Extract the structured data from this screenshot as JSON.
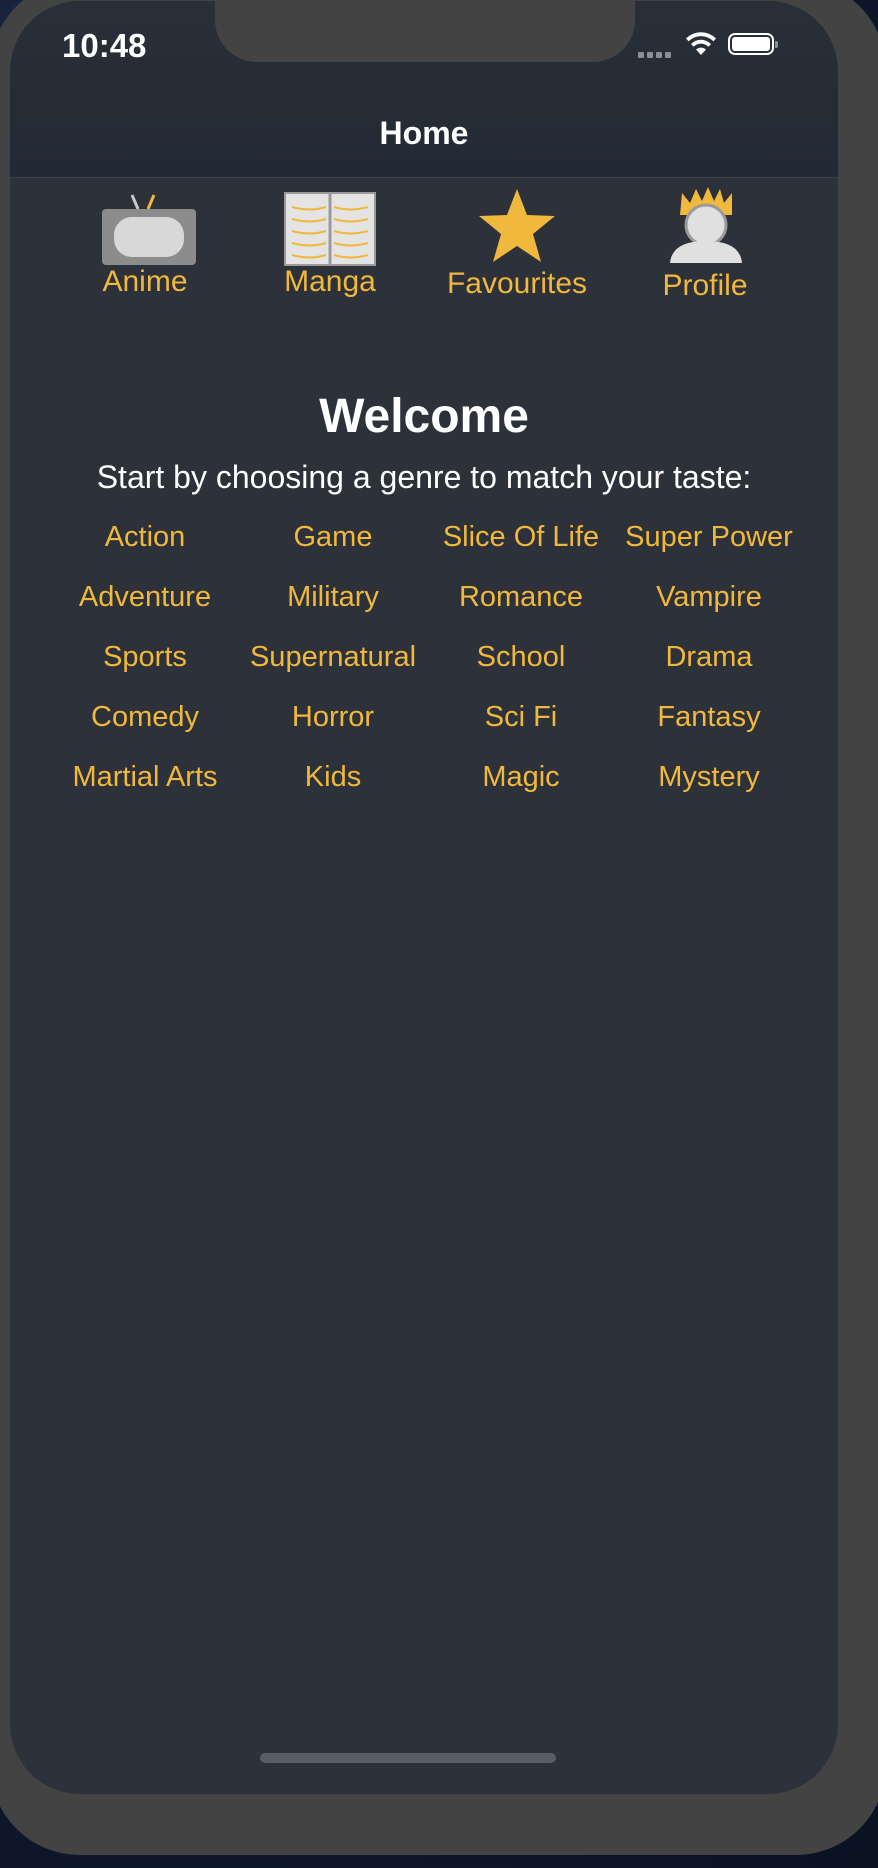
{
  "status_bar": {
    "time": "10:48"
  },
  "navbar": {
    "title": "Home"
  },
  "tabs": [
    {
      "label": "Anime",
      "icon": "tv-icon"
    },
    {
      "label": "Manga",
      "icon": "book-icon"
    },
    {
      "label": "Favourites",
      "icon": "star-icon"
    },
    {
      "label": "Profile",
      "icon": "avatar-icon"
    }
  ],
  "content": {
    "welcome": "Welcome",
    "subtitle": "Start by choosing a genre to match your taste:"
  },
  "genres": [
    "Action",
    "Game",
    "Slice Of Life",
    "Super Power",
    "Adventure",
    "Military",
    "Romance",
    "Vampire",
    "Sports",
    "Supernatural",
    "School",
    "Drama",
    "Comedy",
    "Horror",
    "Sci Fi",
    "Fantasy",
    "Martial Arts",
    "Kids",
    "Magic",
    "Mystery"
  ],
  "colors": {
    "accent": "#f0b83c",
    "background": "#2d3139",
    "navbar": "#232a35",
    "text": "#ffffff"
  }
}
